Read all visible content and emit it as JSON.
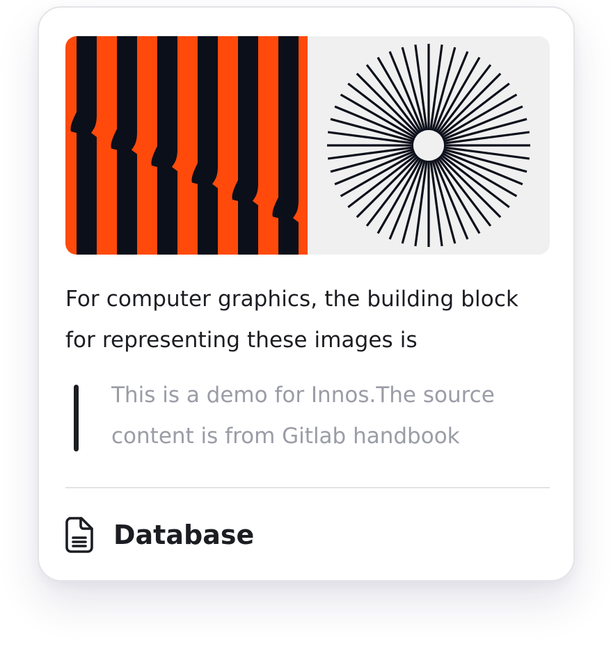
{
  "card": {
    "cover_image": "orange-black-stripes-and-sunburst",
    "description": "For computer graphics, the building block for representing these images is",
    "quote": "This is a demo for Innos.The source content is from Gitlab handbook",
    "footer": {
      "icon": "document-icon",
      "label": "Database"
    }
  },
  "colors": {
    "orange": "#ff4a0b",
    "navy": "#0b0f1a",
    "panel": "#f0f0f0",
    "text": "#1c1d22",
    "muted": "#9a9ca6"
  }
}
